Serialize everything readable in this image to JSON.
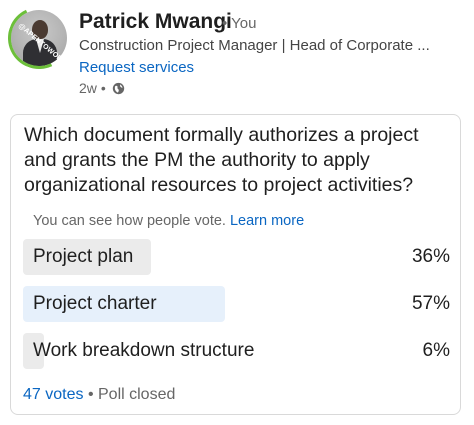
{
  "author": {
    "name": "Patrick Mwangi",
    "degree": "• You",
    "headline": "Construction Project Manager | Head of Corporate ...",
    "request_label": "Request services",
    "avatar_tag": "@APENTOWORK"
  },
  "post": {
    "age": "2w",
    "separator": "•",
    "visibility_icon": "globe-icon"
  },
  "poll": {
    "question": "Which document formally authorizes a project and grants the PM the authority to apply organizational resources to project activities?",
    "vote_note": "You can see how people vote.",
    "learn_more": "Learn more",
    "options": [
      {
        "label": "Project plan",
        "percent": "36%",
        "share": 36,
        "selected": false
      },
      {
        "label": "Project charter",
        "percent": "57%",
        "share": 57,
        "selected": true
      },
      {
        "label": "Work breakdown structure",
        "percent": "6%",
        "share": 6,
        "selected": false
      }
    ],
    "votes_label": "47 votes",
    "footer_separator": "•",
    "status": "Poll closed"
  },
  "colors": {
    "link": "#0a66c2",
    "option_fill": "#ebebeb",
    "selected_fill": "#e6f0fb",
    "avatar_ring": "#6cbf3a"
  }
}
